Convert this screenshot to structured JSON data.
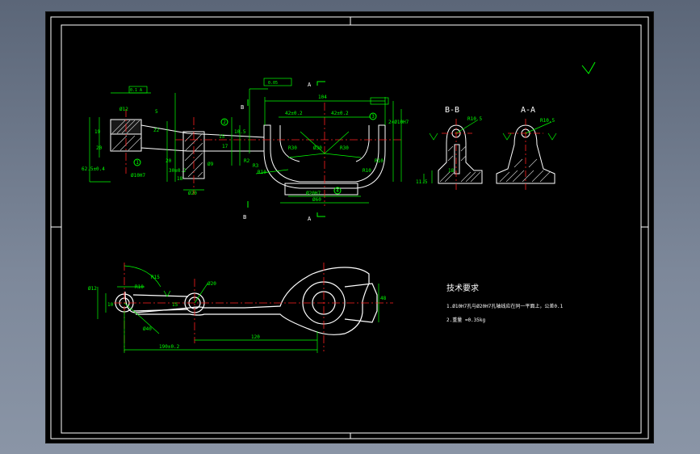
{
  "drawing": {
    "section_bb": "B-B",
    "section_aa": "A-A",
    "cut_a": "A",
    "cut_b": "B",
    "dims_top": [
      "104",
      "42±0.2",
      "42±0.2",
      "Ø30",
      "R30",
      "R30",
      "Ø20H7",
      "Ø60",
      "Ø20",
      "Ø12",
      "R10",
      "R10",
      "R2",
      "Ø9",
      "R3",
      "2×Ø10H7",
      "Ø10H7",
      "22",
      "5",
      "19",
      "10.5",
      "20",
      "62.5±0.4",
      "30±0.2",
      "18",
      "15",
      "17",
      "20",
      "R10"
    ],
    "dims_bb": [
      "R10.5",
      "18",
      "11.5"
    ],
    "dims_aa": [
      "R10.5"
    ],
    "dims_bottom": [
      "Ø12",
      "Ø20",
      "R10",
      "R15",
      "15",
      "10",
      "120",
      "190±0.2",
      "48",
      "Ø40"
    ],
    "balloons": [
      "1",
      "2",
      "3",
      "4"
    ],
    "tech_title": "技术要求",
    "tech_lines": [
      "1.Ø10H7孔与Ø20H7孔轴线应在同一平面上，公差0.1",
      "2.重量 ≈0.35kg"
    ],
    "fcf_labels": [
      "0.1 A",
      "0.05"
    ]
  },
  "colors": {
    "background": "#000000",
    "frame": "#ffffff",
    "dimension": "#00ff00",
    "outline": "#ffffff",
    "center": "#ff2020",
    "text": "#ffffff"
  }
}
